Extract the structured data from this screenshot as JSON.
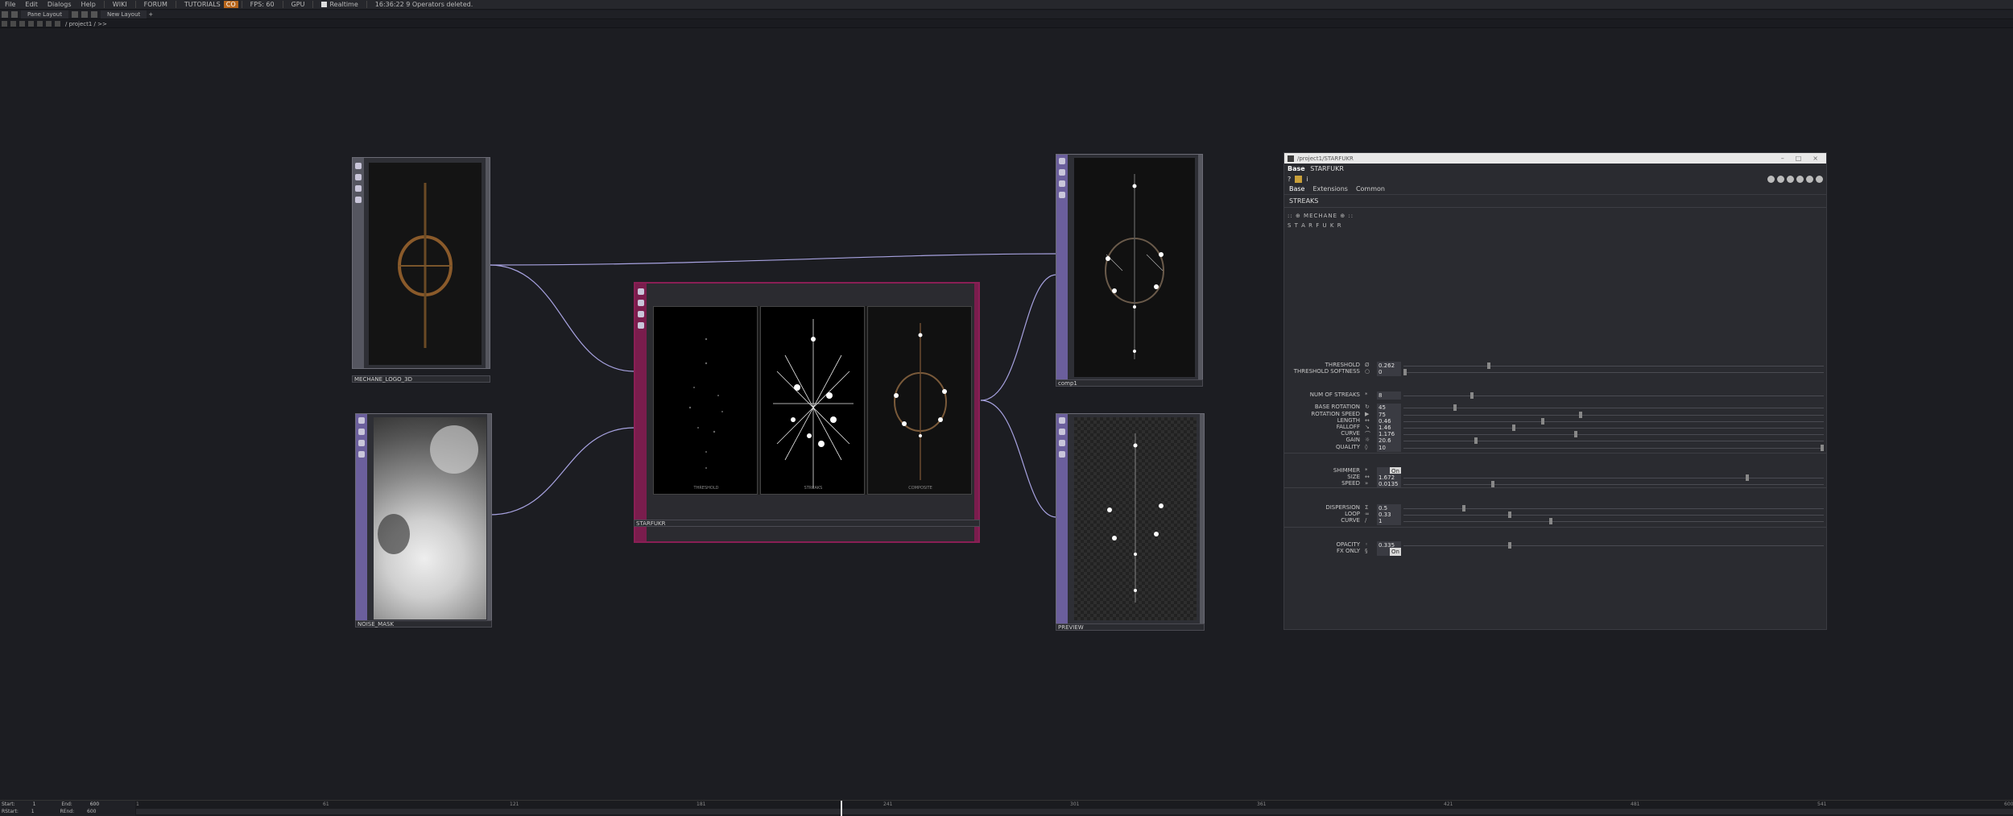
{
  "menu": {
    "items": [
      "File",
      "Edit",
      "Dialogs",
      "Help"
    ],
    "wiki": "WIKI",
    "forum": "FORUM",
    "tutorials": "TUTORIALS",
    "fps_badge": "CO",
    "fps_label": "FPS: 60",
    "gpu": "GPU",
    "realtime": "Realtime",
    "status": "16:36:22 9 Operators deleted."
  },
  "tabbar": {
    "pane_layout": "Pane Layout",
    "new_layout": "New Layout",
    "plus": "+"
  },
  "path": {
    "text": "/ project1 / >>"
  },
  "nodes": {
    "logo": {
      "name": "MECHANE_LOGO_3D"
    },
    "noise": {
      "name": "NOISE_MASK"
    },
    "starfukr": {
      "name": "STARFUKR",
      "panel_labels": [
        "THRESHOLD",
        "STREAKS",
        "COMPOSITE"
      ]
    },
    "comp": {
      "name": "comp1"
    },
    "preview": {
      "name": "PREVIEW"
    }
  },
  "params": {
    "window_title": "/project1/STARFUKR",
    "type": "Base",
    "name": "STARFUKR",
    "help": "?",
    "info": "i",
    "tabs": [
      "Base",
      "Extensions",
      "Common"
    ],
    "section": "STREAKS",
    "line1": ":: ⊕ MECHANE ⊕ ::",
    "line2": "S T A R F U K R",
    "rows": [
      {
        "label": "THRESHOLD",
        "glyph": "Ø",
        "value": "0.262",
        "knob": 0.2
      },
      {
        "label": "THRESHOLD SOFTNESS",
        "glyph": "○",
        "value": "0",
        "knob": 0.0
      },
      {
        "label": "NUM OF STREAKS",
        "glyph": "*",
        "value": "8",
        "knob": 0.16
      },
      {
        "label": "BASE ROTATION",
        "glyph": "↻",
        "value": "45",
        "knob": 0.12
      },
      {
        "label": "ROTATION SPEED",
        "glyph": "▶",
        "value": "75",
        "knob": 0.42
      },
      {
        "label": "LENGTH",
        "glyph": "↔",
        "value": "0.46",
        "knob": 0.33
      },
      {
        "label": "FALLOFF",
        "glyph": "↘",
        "value": "1.46",
        "knob": 0.26
      },
      {
        "label": "CURVE",
        "glyph": "⌒",
        "value": "1.176",
        "knob": 0.41
      },
      {
        "label": "GAIN",
        "glyph": "☼",
        "value": "20.6",
        "knob": 0.17
      },
      {
        "label": "QUALITY",
        "glyph": "◊",
        "value": "10",
        "knob": 1.0
      },
      {
        "label": "SHIMMER",
        "glyph": "*",
        "value": "On",
        "knob": null,
        "toggle": true
      },
      {
        "label": "SIZE",
        "glyph": "↔",
        "value": "1.672",
        "knob": 0.82
      },
      {
        "label": "SPEED",
        "glyph": "»",
        "value": "0.0135",
        "knob": 0.21
      },
      {
        "label": "DISPERSION",
        "glyph": "Σ",
        "value": "0.5",
        "knob": 0.14
      },
      {
        "label": "LOOP",
        "glyph": "∞",
        "value": "0.33",
        "knob": 0.25
      },
      {
        "label": "CURVE",
        "glyph": "/",
        "value": "1",
        "knob": 0.35
      },
      {
        "label": "OPACITY",
        "glyph": "◦",
        "value": "0.335",
        "knob": 0.25
      },
      {
        "label": "FX ONLY",
        "glyph": "§",
        "value": "On",
        "knob": null,
        "toggle": true
      }
    ]
  },
  "timeline": {
    "start_label": "Start:",
    "start": "1",
    "end_label": "End:",
    "end": "600",
    "rstart_label": "RStart:",
    "rstart": "1",
    "rend_label": "REnd:",
    "rend": "600",
    "ticks": [
      "1",
      "61",
      "121",
      "181",
      "241",
      "301",
      "361",
      "421",
      "481",
      "541",
      "600"
    ]
  },
  "colors": {
    "accent_purple": "#6b5f9c",
    "wire": "#a7a2e0",
    "starfukr_border": "#8a1f55",
    "background": "#1c1d22"
  }
}
